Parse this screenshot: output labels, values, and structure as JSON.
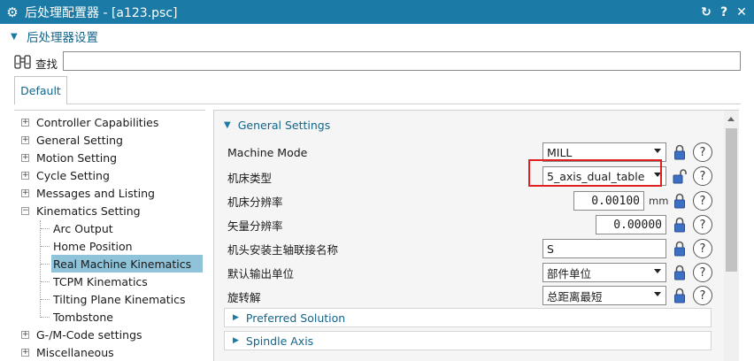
{
  "window": {
    "title": "后处理配置器 - [a123.psc]",
    "icon": "gear-icon",
    "buttons": {
      "refresh": "↻",
      "help": "?",
      "close": "✕"
    }
  },
  "section": {
    "label": "后处理器设置",
    "icon": "triangle-down-icon"
  },
  "search": {
    "label": "查找",
    "value": "",
    "icon": "binoculars-icon"
  },
  "tabs": [
    {
      "label": "Default",
      "active": true
    }
  ],
  "tree": {
    "items": [
      {
        "label": "Controller Capabilities",
        "expander": "+"
      },
      {
        "label": "General Setting",
        "expander": "+"
      },
      {
        "label": "Motion Setting",
        "expander": "+"
      },
      {
        "label": "Cycle Setting",
        "expander": "+"
      },
      {
        "label": "Messages and Listing",
        "expander": "+"
      },
      {
        "label": "Kinematics Setting",
        "expander": "−"
      },
      {
        "label": "Arc Output"
      },
      {
        "label": "Home Position"
      },
      {
        "label": "Real Machine Kinematics",
        "selected": true
      },
      {
        "label": "TCPM Kinematics"
      },
      {
        "label": "Tilting Plane Kinematics"
      },
      {
        "label": "Tombstone"
      },
      {
        "label": "G-/M-Code settings",
        "expander": "+"
      },
      {
        "label": "Miscellaneous",
        "expander": "+"
      }
    ]
  },
  "general_settings": {
    "header": "General Settings",
    "rows": [
      {
        "label": "Machine Mode",
        "value": "MILL",
        "control": "select"
      },
      {
        "label": "机床类型",
        "value": "5_axis_dual_table",
        "control": "select",
        "highlighted": true,
        "lock": "unlocked"
      },
      {
        "label": "机床分辨率",
        "value": "0.00100",
        "unit": "mm",
        "control": "number"
      },
      {
        "label": "矢量分辨率",
        "value": "0.00000",
        "control": "number"
      },
      {
        "label": "机头安装主轴联接名称",
        "value": "S",
        "control": "text"
      },
      {
        "label": "默认输出单位",
        "value": "部件单位",
        "control": "select"
      },
      {
        "label": "旋转解",
        "value": "总距离最短",
        "control": "select"
      }
    ]
  },
  "collapsed_groups": [
    {
      "label": "Preferred Solution"
    },
    {
      "label": "Spindle Axis"
    }
  ],
  "colors": {
    "titlebar": "#1b7ba6",
    "accent_text": "#14658a",
    "selection": "#8fc3d9",
    "highlight_border": "#e02020",
    "lock_locked": "#3d6fc4"
  }
}
